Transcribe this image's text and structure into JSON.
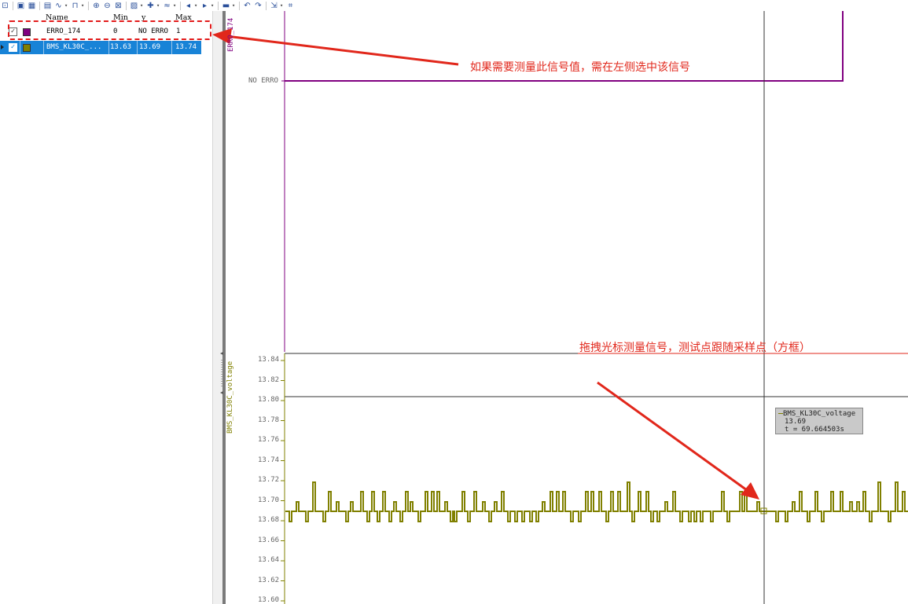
{
  "toolbar": {
    "buttons": [
      "zoom-fit",
      "separator",
      "graph-view-a",
      "graph-view-b",
      "separator",
      "chart-stacked",
      "chart-sine",
      "chart-step",
      "separator",
      "zoom-in",
      "zoom-out",
      "zoom-area",
      "separator",
      "chart-options",
      "signal-add",
      "signal-wave",
      "separator",
      "nav-prev",
      "nav-next",
      "separator",
      "save",
      "separator",
      "undo",
      "redo",
      "separator",
      "export",
      "measure"
    ]
  },
  "signal_list": {
    "headers": {
      "name": "Name",
      "min": "Min",
      "y": "y",
      "max": "Max"
    },
    "rows": [
      {
        "name": "ERRO_174",
        "min": "0",
        "y": "NO ERRO",
        "max": "1",
        "checked": true,
        "color": "#800080",
        "selected": false
      },
      {
        "name": "BMS_KL30C_...",
        "min": "13.63",
        "y": "13.69",
        "max": "13.74",
        "checked": true,
        "color": "#808000",
        "selected": true
      }
    ]
  },
  "annotations": {
    "top": "如果需要测量此信号值，需在左侧选中该信号",
    "bottom": "拖拽光标测量信号，测试点跟随采样点（方框）"
  },
  "graph1": {
    "signal": "ERRO_174",
    "ylabel": "ERRO_174",
    "level_label": "NO ERRO",
    "color": "#800080"
  },
  "graph2": {
    "signal": "BMS_KL30C_voltage",
    "ylabel": "BMS_KL30C_voltage",
    "color": "#808000",
    "ticks": [
      "13.84",
      "13.82",
      "13.80",
      "13.78",
      "13.76",
      "13.74",
      "13.72",
      "13.70",
      "13.68",
      "13.66",
      "13.64",
      "13.62",
      "13.60"
    ]
  },
  "cursor": {
    "tooltip_signal": "BMS_KL30C_voltage",
    "tooltip_value": "13.69",
    "tooltip_time": "t = 69.664503s"
  },
  "colors": {
    "accent_red": "#e1271b",
    "selection_blue": "#1883d7"
  }
}
